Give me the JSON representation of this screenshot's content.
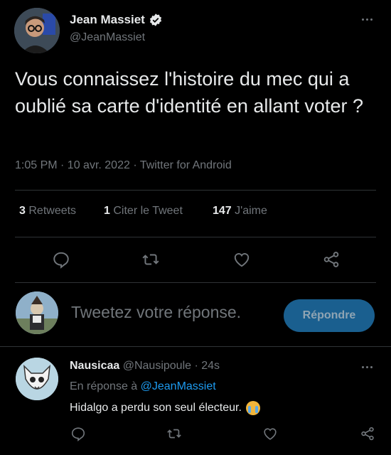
{
  "tweet": {
    "author_name": "Jean Massiet",
    "author_handle": "@JeanMassiet",
    "text": "Vous connaissez l'histoire du mec qui a oublié sa carte d'identité en allant voter ?",
    "meta": "1:05 PM · 10 avr. 2022 · Twitter for Android",
    "stats": {
      "retweets_count": "3",
      "retweets_label": "Retweets",
      "quotes_count": "1",
      "quotes_label": "Citer le Tweet",
      "likes_count": "147",
      "likes_label": "J'aime"
    }
  },
  "compose": {
    "placeholder": "Tweetez votre réponse.",
    "button_label": "Répondre"
  },
  "reply": {
    "author_name": "Nausicaa",
    "author_handle": "@Nausipoule",
    "separator": "·",
    "time": "24s",
    "replying_prefix": "En réponse à",
    "replying_to": "@JeanMassiet",
    "text": "Hidalgo a perdu son seul électeur."
  },
  "colors": {
    "accent": "#1d9bf0",
    "muted": "#71767b",
    "background": "#000000",
    "text": "#e7e9ea"
  },
  "icons": [
    "verified-badge-icon",
    "more-icon",
    "reply-icon",
    "retweet-icon",
    "like-icon",
    "share-icon",
    "sob-emoji-icon"
  ]
}
